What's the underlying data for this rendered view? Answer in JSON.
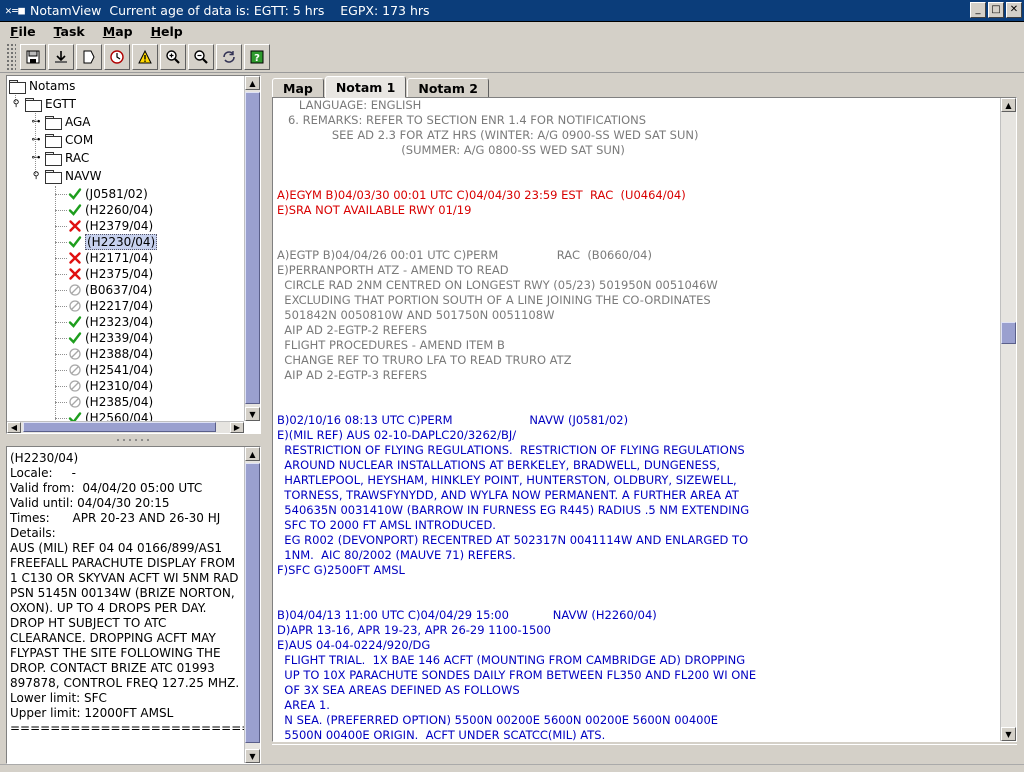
{
  "window": {
    "app_name": "NotamView",
    "title_info": "Current age of data is: EGTT: 5 hrs    EGPX: 173 hrs",
    "minimize": "_",
    "maximize": "□",
    "close": "✕"
  },
  "menu": [
    {
      "label": "File",
      "accel": "F",
      "rest": "ile"
    },
    {
      "label": "Task",
      "accel": "T",
      "rest": "ask"
    },
    {
      "label": "Map",
      "accel": "M",
      "rest": "ap"
    },
    {
      "label": "Help",
      "accel": "H",
      "rest": "elp"
    }
  ],
  "toolbar": [
    {
      "name": "save-icon"
    },
    {
      "name": "download-icon"
    },
    {
      "name": "next-page-icon"
    },
    {
      "name": "clock-icon"
    },
    {
      "name": "warning-icon"
    },
    {
      "name": "zoom-in-icon"
    },
    {
      "name": "zoom-out-icon"
    },
    {
      "name": "refresh-icon"
    },
    {
      "name": "help-icon"
    }
  ],
  "tree": {
    "root": "Notams",
    "region": "EGTT",
    "groups": [
      "AGA",
      "COM",
      "RAC",
      "NAVW"
    ],
    "items": [
      {
        "id": "(J0581/02)",
        "status": "check"
      },
      {
        "id": "(H2260/04)",
        "status": "check"
      },
      {
        "id": "(H2379/04)",
        "status": "cross"
      },
      {
        "id": "(H2230/04)",
        "status": "check",
        "selected": true
      },
      {
        "id": "(H2171/04)",
        "status": "cross"
      },
      {
        "id": "(H2375/04)",
        "status": "cross"
      },
      {
        "id": "(B0637/04)",
        "status": "none"
      },
      {
        "id": "(H2217/04)",
        "status": "none"
      },
      {
        "id": "(H2323/04)",
        "status": "check"
      },
      {
        "id": "(H2339/04)",
        "status": "check"
      },
      {
        "id": "(H2388/04)",
        "status": "none"
      },
      {
        "id": "(H2541/04)",
        "status": "none"
      },
      {
        "id": "(H2310/04)",
        "status": "none"
      },
      {
        "id": "(H2385/04)",
        "status": "none"
      },
      {
        "id": "(H2560/04)",
        "status": "check"
      }
    ]
  },
  "details": {
    "lines": [
      "(H2230/04)",
      "Locale:     -",
      "Valid from:  04/04/20 05:00 UTC",
      "Valid until: 04/04/30 20:15",
      "Times:      APR 20-23 AND 26-30 HJ",
      "Details:",
      "AUS (MIL) REF 04 04 0166/899/AS1",
      "FREEFALL PARACHUTE DISPLAY FROM",
      "1 C130 OR SKYVAN ACFT WI 5NM RAD",
      "PSN 5145N 00134W (BRIZE NORTON,",
      "OXON). UP TO 4 DROPS PER DAY.",
      "DROP HT SUBJECT TO ATC",
      "CLEARANCE. DROPPING ACFT MAY",
      "FLYPAST THE SITE FOLLOWING THE",
      "DROP. CONTACT BRIZE ATC 01993",
      "897878, CONTROL FREQ 127.25 MHZ.",
      "Lower limit: SFC",
      "Upper limit: 12000FT AMSL",
      "========================"
    ]
  },
  "tabs": [
    {
      "label": "Map",
      "active": false
    },
    {
      "label": "Notam 1",
      "active": true
    },
    {
      "label": "Notam 2",
      "active": false
    }
  ],
  "document": {
    "lines": [
      {
        "text": "      LANGUAGE: ENGLISH",
        "color": "grey"
      },
      {
        "text": "   6. REMARKS: REFER TO SECTION ENR 1.4 FOR NOTIFICATIONS",
        "color": "grey"
      },
      {
        "text": "               SEE AD 2.3 FOR ATZ HRS (WINTER: A/G 0900-SS WED SAT SUN)",
        "color": "grey"
      },
      {
        "text": "                                  (SUMMER: A/G 0800-SS WED SAT SUN)",
        "color": "grey"
      },
      {
        "text": "",
        "color": "grey"
      },
      {
        "text": "",
        "color": "grey"
      },
      {
        "text": "A)EGYM B)04/03/30 00:01 UTC C)04/04/30 23:59 EST  RAC  (U0464/04)",
        "color": "red"
      },
      {
        "text": "E)SRA NOT AVAILABLE RWY 01/19",
        "color": "red"
      },
      {
        "text": "",
        "color": "grey"
      },
      {
        "text": "",
        "color": "grey"
      },
      {
        "text": "A)EGTP B)04/04/26 00:01 UTC C)PERM                RAC  (B0660/04)",
        "color": "grey"
      },
      {
        "text": "E)PERRANPORTH ATZ - AMEND TO READ",
        "color": "grey"
      },
      {
        "text": "  CIRCLE RAD 2NM CENTRED ON LONGEST RWY (05/23) 501950N 0051046W",
        "color": "grey"
      },
      {
        "text": "  EXCLUDING THAT PORTION SOUTH OF A LINE JOINING THE CO-ORDINATES",
        "color": "grey"
      },
      {
        "text": "  501842N 0050810W AND 501750N 0051108W",
        "color": "grey"
      },
      {
        "text": "  AIP AD 2-EGTP-2 REFERS",
        "color": "grey"
      },
      {
        "text": "  FLIGHT PROCEDURES - AMEND ITEM B",
        "color": "grey"
      },
      {
        "text": "  CHANGE REF TO TRURO LFA TO READ TRURO ATZ",
        "color": "grey"
      },
      {
        "text": "  AIP AD 2-EGTP-3 REFERS",
        "color": "grey"
      },
      {
        "text": "",
        "color": "grey"
      },
      {
        "text": "",
        "color": "grey"
      },
      {
        "text": "B)02/10/16 08:13 UTC C)PERM                     NAVW (J0581/02)",
        "color": "blue"
      },
      {
        "text": "E)(MIL REF) AUS 02-10-DAPLC20/3262/BJ/",
        "color": "blue"
      },
      {
        "text": "  RESTRICTION OF FLYING REGULATIONS.  RESTRICTION OF FLYING REGULATIONS",
        "color": "blue"
      },
      {
        "text": "  AROUND NUCLEAR INSTALLATIONS AT BERKELEY, BRADWELL, DUNGENESS,",
        "color": "blue"
      },
      {
        "text": "  HARTLEPOOL, HEYSHAM, HINKLEY POINT, HUNTERSTON, OLDBURY, SIZEWELL,",
        "color": "blue"
      },
      {
        "text": "  TORNESS, TRAWSFYNYDD, AND WYLFA NOW PERMANENT. A FURTHER AREA AT",
        "color": "blue"
      },
      {
        "text": "  540635N 0031410W (BARROW IN FURNESS EG R445) RADIUS .5 NM EXTENDING",
        "color": "blue"
      },
      {
        "text": "  SFC TO 2000 FT AMSL INTRODUCED.",
        "color": "blue"
      },
      {
        "text": "  EG R002 (DEVONPORT) RECENTRED AT 502317N 0041114W AND ENLARGED TO",
        "color": "blue"
      },
      {
        "text": "  1NM.  AIC 80/2002 (MAUVE 71) REFERS.",
        "color": "blue"
      },
      {
        "text": "F)SFC G)2500FT AMSL",
        "color": "blue"
      },
      {
        "text": "",
        "color": "grey"
      },
      {
        "text": "",
        "color": "grey"
      },
      {
        "text": "B)04/04/13 11:00 UTC C)04/04/29 15:00            NAVW (H2260/04)",
        "color": "blue"
      },
      {
        "text": "D)APR 13-16, APR 19-23, APR 26-29 1100-1500",
        "color": "blue"
      },
      {
        "text": "E)AUS 04-04-0224/920/DG",
        "color": "blue"
      },
      {
        "text": "  FLIGHT TRIAL.  1X BAE 146 ACFT (MOUNTING FROM CAMBRIDGE AD) DROPPING",
        "color": "blue"
      },
      {
        "text": "  UP TO 10X PARACHUTE SONDES DAILY FROM BETWEEN FL350 AND FL200 WI ONE",
        "color": "blue"
      },
      {
        "text": "  OF 3X SEA AREAS DEFINED AS FOLLOWS",
        "color": "blue"
      },
      {
        "text": "  AREA 1.",
        "color": "blue"
      },
      {
        "text": "  N SEA. (PREFERRED OPTION) 5500N 00200E 5600N 00200E 5600N 00400E",
        "color": "blue"
      },
      {
        "text": "  5500N 00400E ORIGIN.  ACFT UNDER SCATCC(MIL) ATS.",
        "color": "blue"
      }
    ]
  }
}
